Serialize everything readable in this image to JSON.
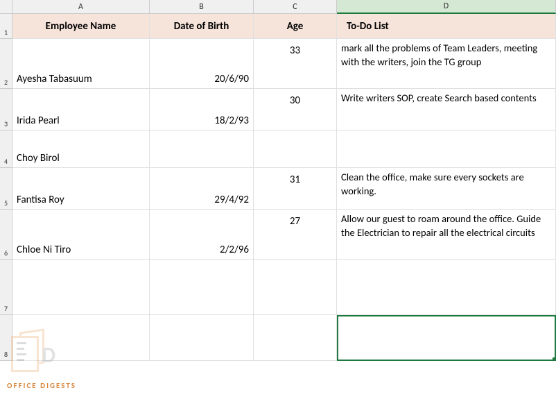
{
  "columns": [
    "A",
    "B",
    "C",
    "D"
  ],
  "selectedColumn": "D",
  "rowNumbers": [
    "1",
    "2",
    "3",
    "4",
    "5",
    "6",
    "7",
    "8"
  ],
  "headers": {
    "name": "Employee Name",
    "dob": "Date of Birth",
    "age": "Age",
    "todo": "To-Do List"
  },
  "rows": [
    {
      "name": "Ayesha Tabasuum",
      "dob": "20/6/90",
      "age": "33",
      "todo": "mark all the problems of Team Leaders, meeting with the writers, join the TG group"
    },
    {
      "name": "Irida Pearl",
      "dob": "18/2/93",
      "age": "30",
      "todo": "Write writers SOP, create Search based contents"
    },
    {
      "name": "Choy Birol",
      "dob": "",
      "age": "",
      "todo": ""
    },
    {
      "name": "Fantisa Roy",
      "dob": "29/4/92",
      "age": "31",
      "todo": "Clean the office, make sure every sockets are working."
    },
    {
      "name": "Chloe Ni Tiro",
      "dob": "2/2/96",
      "age": "27",
      "todo": "Allow our guest to roam around the office. Guide the Electrician to repair all the electrical circuits"
    }
  ],
  "watermark": {
    "letter": "D",
    "text": "OFFICE DIGESTS"
  },
  "rowHeights": {
    "header": 36,
    "r2": 72,
    "r3": 60,
    "r4": 54,
    "r5": 60,
    "r6": 72,
    "r7": 80,
    "r8": 66
  }
}
